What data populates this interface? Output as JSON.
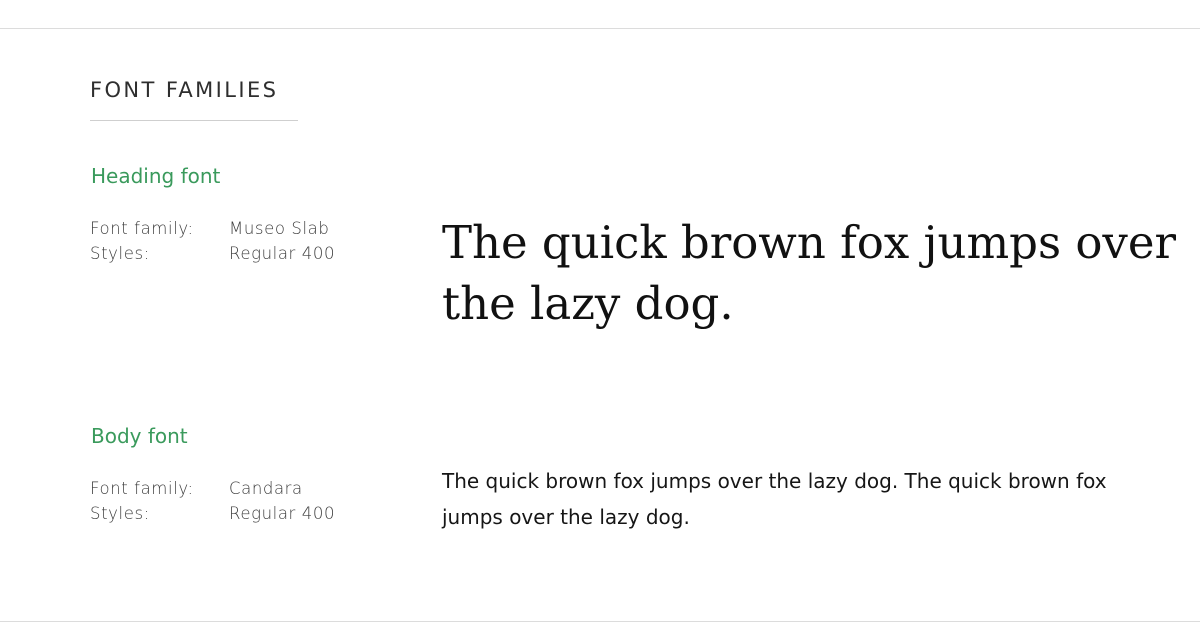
{
  "section": {
    "title": "FONT FAMILIES"
  },
  "heading_font": {
    "title": "Heading font",
    "family_label": "Font family:",
    "family_value": "Museo Slab",
    "styles_label": "Styles:",
    "styles_value": "Regular 400",
    "sample": "The quick brown fox jumps over the lazy dog."
  },
  "body_font": {
    "title": "Body font",
    "family_label": "Font family:",
    "family_value": "Candara",
    "styles_label": "Styles:",
    "styles_value": "Regular 400",
    "sample": "The quick brown fox jumps over the lazy dog. The quick brown fox jumps over the lazy dog."
  },
  "colors": {
    "accent": "#3a9a5c",
    "text": "#2b2b2b",
    "rule": "#dcdcdc"
  }
}
